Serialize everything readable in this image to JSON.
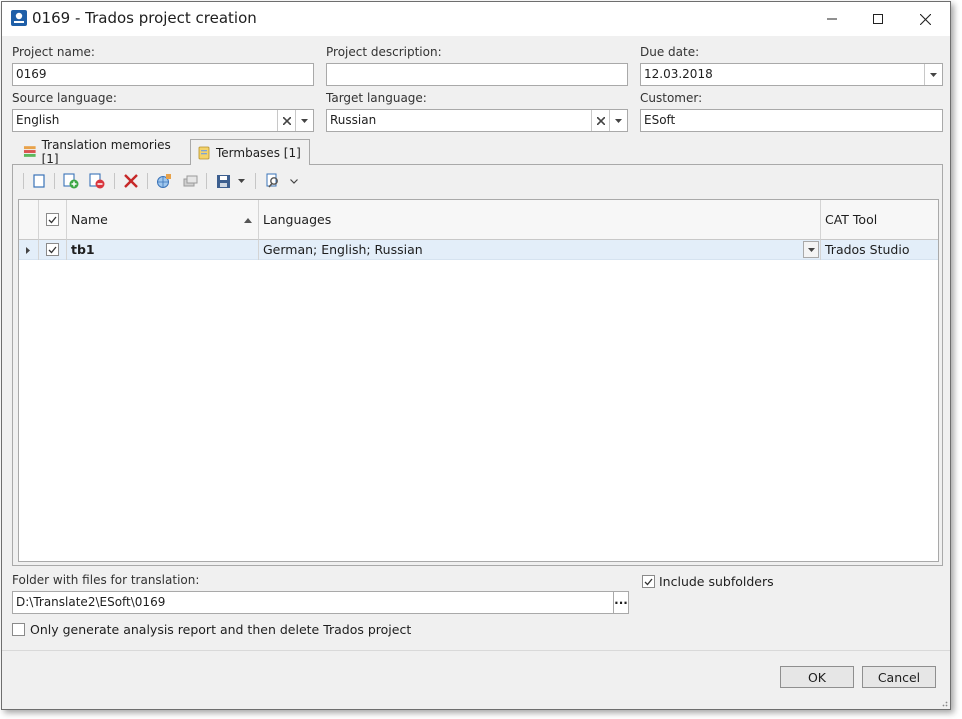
{
  "window": {
    "title": "0169 - Trados project creation"
  },
  "fields": {
    "project_name": {
      "label": "Project name:",
      "value": "0169"
    },
    "project_description": {
      "label": "Project description:",
      "value": ""
    },
    "due_date": {
      "label": "Due date:",
      "value": "12.03.2018"
    },
    "source_language": {
      "label": "Source language:",
      "value": "English"
    },
    "target_language": {
      "label": "Target language:",
      "value": "Russian"
    },
    "customer": {
      "label": "Customer:",
      "value": "ESoft"
    }
  },
  "tabs": [
    {
      "label": "Translation memories [1]",
      "active": false
    },
    {
      "label": "Termbases [1]",
      "active": true
    }
  ],
  "grid": {
    "columns": [
      "Name",
      "Languages",
      "CAT Tool"
    ],
    "rows": [
      {
        "checked": true,
        "name": "tb1",
        "languages": "German; English; Russian",
        "cat_tool": "Trados Studio"
      }
    ]
  },
  "folder": {
    "label": "Folder with files for translation:",
    "value": "D:\\Translate2\\ESoft\\0169",
    "browse": "..."
  },
  "include_subfolders": {
    "label": "Include subfolders",
    "checked": true
  },
  "only_report": {
    "label": "Only generate analysis report and then delete Trados project",
    "checked": false
  },
  "buttons": {
    "ok": "OK",
    "cancel": "Cancel"
  },
  "colors": {
    "window_bg": "#f0f0f0",
    "selected_row": "#e3eef9",
    "delete_red": "#c62828"
  }
}
